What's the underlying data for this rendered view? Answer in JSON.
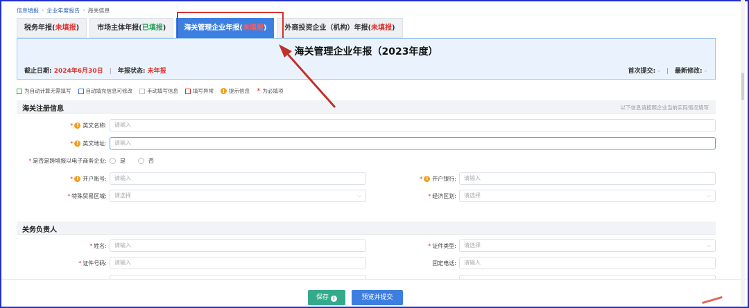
{
  "breadcrumb": [
    "信息填报",
    "企业年度报告",
    "海关信息"
  ],
  "tabs": [
    {
      "name": "税务年报",
      "status": "未填报",
      "state": "pending"
    },
    {
      "name": "市场主体年报",
      "status": "已填报",
      "state": "done"
    },
    {
      "name": "海关管理企业年报",
      "status": "未填报",
      "state": "pending",
      "active": true
    },
    {
      "name": "外商投资企业（机构）年报",
      "status": "未填报",
      "state": "pending"
    }
  ],
  "header": {
    "title": "海关管理企业年报（2023年度）",
    "deadline_label": "截止日期:",
    "deadline_value": "2024年6月30日",
    "status_label": "年报状态:",
    "status_value": "未年报",
    "first_submit_label": "首次提交:",
    "first_submit_value": "-",
    "last_modified_label": "最新修改:",
    "last_modified_value": "-"
  },
  "legend": [
    {
      "text": "为自动计算无需填写",
      "kind": "green-box"
    },
    {
      "text": "自动填充信息可修改",
      "kind": "blue-box"
    },
    {
      "text": "手动填写信息",
      "kind": "gray-box"
    },
    {
      "text": "填写异常",
      "kind": "red-box"
    },
    {
      "text": "提示信息",
      "kind": "tip-icon"
    },
    {
      "text": "为必填项",
      "kind": "required-star"
    }
  ],
  "section_customs": {
    "title": "海关注册信息",
    "note": "以下信息请按照企业当前实际情况填写"
  },
  "fields": {
    "en_name": {
      "label": "英文名称:",
      "placeholder": "请输入"
    },
    "en_address": {
      "label": "英文地址:",
      "placeholder": "请输入"
    },
    "ecommerce": {
      "label": "是否是跨境报以电子商务企业:",
      "options": [
        "是",
        "否"
      ]
    },
    "account_no": {
      "label": "开户账号:",
      "placeholder": "请输入"
    },
    "bank": {
      "label": "开户银行:",
      "placeholder": "请输入"
    },
    "special_zone": {
      "label": "特殊贸易区域:",
      "placeholder": "请选择"
    },
    "economic_zone": {
      "label": "经济区划:",
      "placeholder": "请选择"
    }
  },
  "section_officer": {
    "title": "关务负责人"
  },
  "officer_fields": {
    "name": {
      "label": "姓名:",
      "placeholder": "请输入"
    },
    "id_type": {
      "label": "证件类型:",
      "placeholder": "请选择"
    },
    "id_no": {
      "label": "证件号码:",
      "placeholder": "请输入"
    },
    "phone": {
      "label": "固定电话:",
      "placeholder": "请输入"
    }
  },
  "footer": {
    "save": "保存",
    "preview": "预览并提交"
  },
  "colors": {
    "accent": "#3d7fe0",
    "warning": "#e0322e",
    "success": "#29a35a",
    "annotation": "#d8302a"
  }
}
